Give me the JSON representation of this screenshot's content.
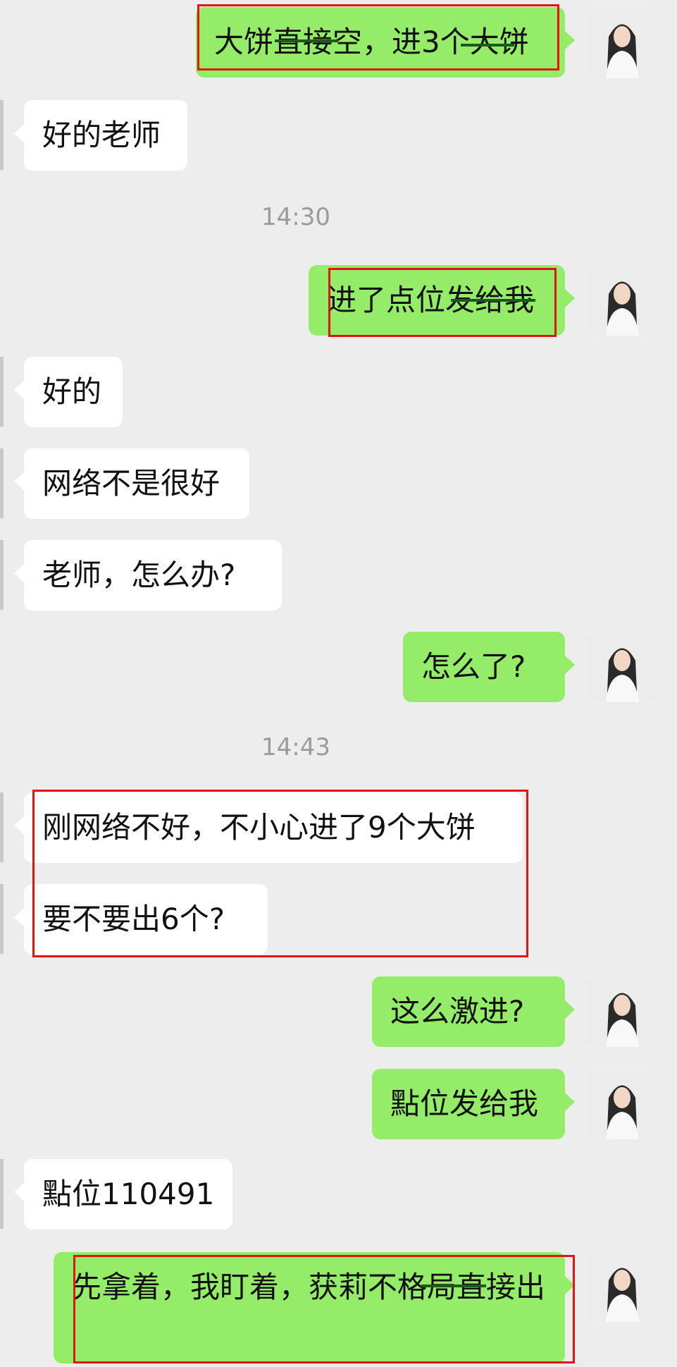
{
  "messages": [
    {
      "dir": "out",
      "text": "大饼直接空，进3个大饼"
    },
    {
      "dir": "in",
      "text": "好的老师"
    },
    {
      "dir": "out",
      "text": "进了点位发给我"
    },
    {
      "dir": "in",
      "text": "好的"
    },
    {
      "dir": "in",
      "text": "网络不是很好"
    },
    {
      "dir": "in",
      "text": "老师，怎么办?"
    },
    {
      "dir": "out",
      "text": "怎么了?"
    },
    {
      "dir": "in",
      "text": "刚网络不好，不小心进了9个大饼"
    },
    {
      "dir": "in",
      "text": "要不要出6个?"
    },
    {
      "dir": "out",
      "text": "这么激进?"
    },
    {
      "dir": "out",
      "text": "點位发给我"
    },
    {
      "dir": "in",
      "text": "點位110491"
    },
    {
      "dir": "out",
      "text": "先拿着，我盯着，获莉不格局直接出"
    }
  ],
  "timestamps": [
    "14:30",
    "14:43"
  ],
  "colors": {
    "outgoing_bubble": "#95ec69",
    "incoming_bubble": "#ffffff",
    "background": "#ededed",
    "annotation_box": "#e31414"
  }
}
